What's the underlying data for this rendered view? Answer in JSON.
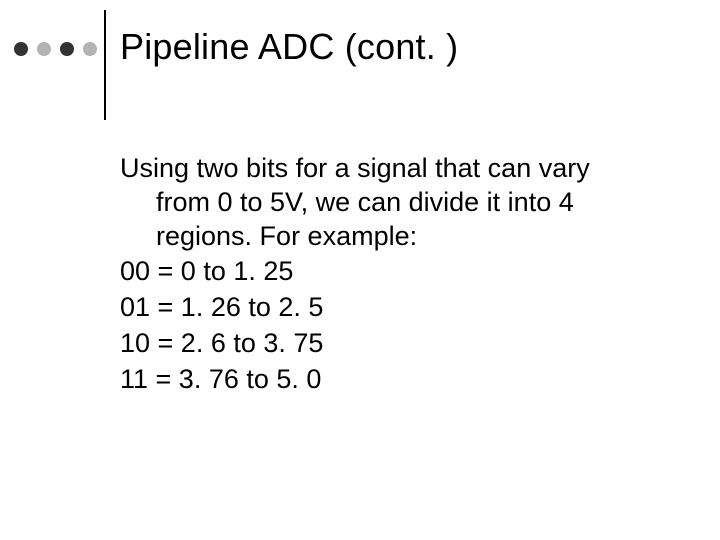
{
  "title": "Pipeline ADC (cont. )",
  "intro": {
    "line1": "Using two bits for a signal that can vary",
    "line2": "from 0 to 5V, we can divide it into 4",
    "line3": "regions.  For example:"
  },
  "rows": {
    "r1": "00 = 0 to 1. 25",
    "r2": "01 = 1. 26 to 2. 5",
    "r3": "10 = 2. 6 to 3. 75",
    "r4": "11 = 3. 76 to 5. 0"
  }
}
